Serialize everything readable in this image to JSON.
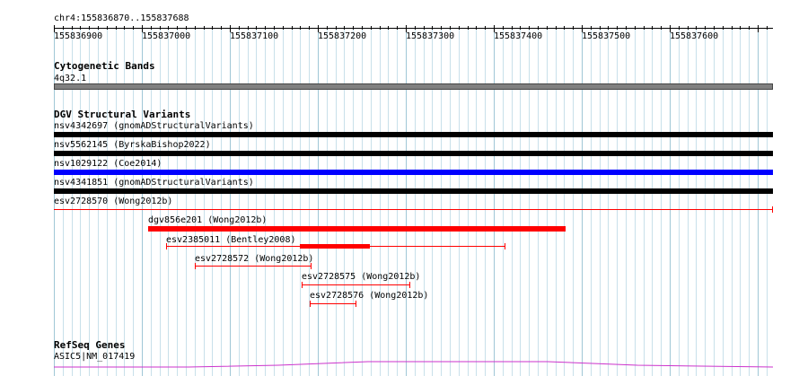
{
  "location": "chr4:155836870..155837688",
  "ruler": {
    "tick_labels": [
      "155836900",
      "155837000",
      "155837100",
      "155837200",
      "155837300",
      "155837400",
      "155837500",
      "155837600"
    ]
  },
  "tracks": {
    "cytoband": {
      "title": "Cytogenetic Bands",
      "band_label": "4q32.1",
      "band_color": "#808080"
    },
    "dgv": {
      "title": "DGV Structural Variants",
      "features": [
        {
          "label": "nsv4342697 (gnomADStructuralVariants)",
          "color": "#000000"
        },
        {
          "label": "nsv5562145 (ByrskaBishop2022)",
          "color": "#000000"
        },
        {
          "label": "nsv1029122 (Coe2014)",
          "color": "#0000ff"
        },
        {
          "label": "nsv4341851 (gnomADStructuralVariants)",
          "color": "#000000"
        },
        {
          "label": "esv2728570 (Wong2012b)",
          "color": "#ff0000"
        },
        {
          "label": "dgv856e201 (Wong2012b)",
          "color": "#ff0000"
        },
        {
          "label": "esv2385011 (Bentley2008)",
          "color": "#ff0000"
        },
        {
          "label": "esv2728572 (Wong2012b)",
          "color": "#ff0000"
        },
        {
          "label": "esv2728575 (Wong2012b)",
          "color": "#ff0000"
        },
        {
          "label": "esv2728576 (Wong2012b)",
          "color": "#ff0000"
        }
      ]
    },
    "refseq": {
      "title": "RefSeq Genes",
      "gene_label": "ASIC5|NM_017419",
      "color": "#cc33cc"
    }
  }
}
